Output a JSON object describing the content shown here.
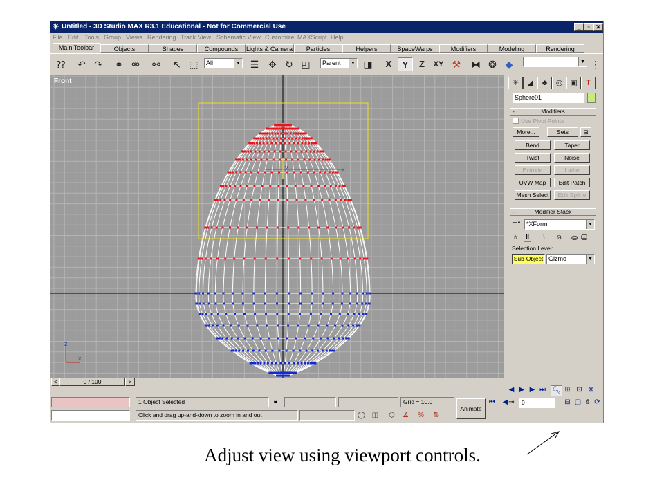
{
  "window": {
    "title": "Untitled - 3D Studio MAX R3.1 Educational - Not for Commercial Use",
    "app_icon": "max-logo-icon",
    "controls": [
      "_",
      "▫",
      "✕"
    ]
  },
  "menubar": [
    "File",
    "Edit",
    "Tools",
    "Group",
    "Views",
    "Rendering",
    "Track View",
    "Schematic View",
    "Customize",
    "MAXScript",
    "Help"
  ],
  "tabs": [
    "Main Toolbar",
    "Objects",
    "Shapes",
    "Compounds",
    "Lights & Cameras",
    "Particles",
    "Helpers",
    "SpaceWarps",
    "Modifiers",
    "Modeling",
    "Rendering"
  ],
  "toolbar": {
    "selection_filter": "All",
    "coord_system": "Parent",
    "axis_x": "X",
    "axis_y": "Y",
    "axis_z": "Z",
    "axis_xy": "XY",
    "named_selection": ""
  },
  "viewport": {
    "label": "Front",
    "axis_z_label": "z",
    "axis_x_label": "x",
    "gizmo_y_label": "y"
  },
  "time_slider": {
    "value": "0 / 100",
    "prev": "<",
    "next": ">"
  },
  "command_panel": {
    "object_name": "Sphere01",
    "object_color": "#c8ec7c",
    "modifiers_rollout": {
      "title": "Modifiers",
      "collapse": "-",
      "use_pivot_points": "Use Pivot Points",
      "more": "More...",
      "sets": "Sets",
      "buttons": [
        "Bend",
        "Taper",
        "Twist",
        "Noise",
        "Extrude",
        "Lathe",
        "UVW Map",
        "Edit Patch",
        "Mesh Select",
        "Edit Spline"
      ]
    },
    "stack_rollout": {
      "title": "Modifier Stack",
      "collapse": "-",
      "current": "*XForm",
      "selection_level_label": "Selection Level:",
      "sub_object": "Sub-Object",
      "level": "Gizmo"
    }
  },
  "statusbar": {
    "objects_selected": "1 Object Selected",
    "prompt": "Click and drag up-and-down to zoom in and out",
    "grid": "Grid = 10.0",
    "animate": "Animate",
    "frame": "0"
  },
  "colors": {
    "titlebar": "#0a246a",
    "viewport_bg": "#9c9c9c",
    "selected_vertex": "#e8141c",
    "unselected_vertex": "#1428d0",
    "gizmo_box": "#f0e020",
    "sub_object_highlight": "#ffff60"
  },
  "caption": "Adjust view using viewport controls."
}
